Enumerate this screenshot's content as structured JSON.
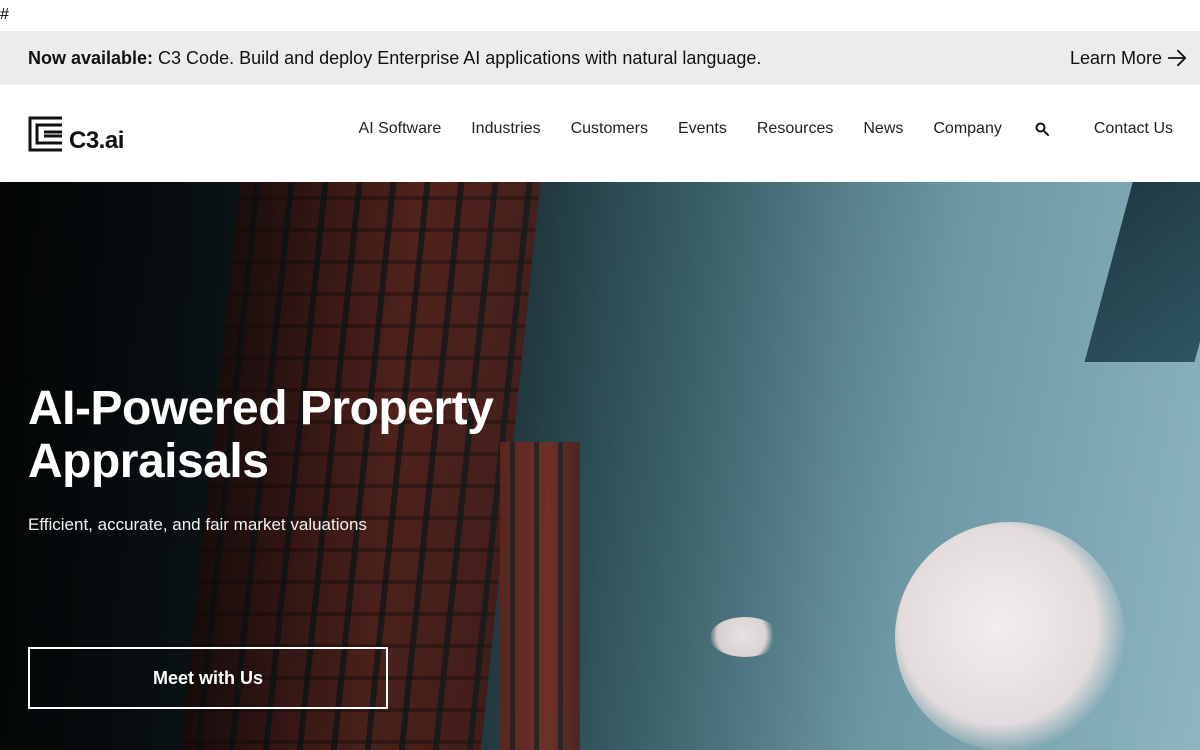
{
  "stray_text": "#",
  "announcement": {
    "prefix": "Now available:",
    "message": " C3 Code. Build and deploy Enterprise AI applications with natural language.",
    "link_label": "Learn More",
    "link_icon": "arrow-right-icon"
  },
  "header": {
    "logo_text": "C3.ai",
    "logo_icon": "c3-logo-icon",
    "menu": [
      {
        "label": "AI Software"
      },
      {
        "label": "Industries"
      },
      {
        "label": "Customers"
      },
      {
        "label": "Events"
      },
      {
        "label": "Resources"
      },
      {
        "label": "News"
      },
      {
        "label": "Company"
      }
    ],
    "search_icon": "search-icon",
    "contact_label": "Contact Us"
  },
  "hero": {
    "title": "AI-Powered Property\nAppraisals",
    "subtitle": "Efficient, accurate, and fair market valuations",
    "cta_label": "Meet with Us",
    "background": "photo of red brick high-rise buildings against a blue sky with clouds"
  },
  "colors": {
    "announcement_bg": "#ececec",
    "text": "#111111",
    "hero_text": "#ffffff"
  }
}
